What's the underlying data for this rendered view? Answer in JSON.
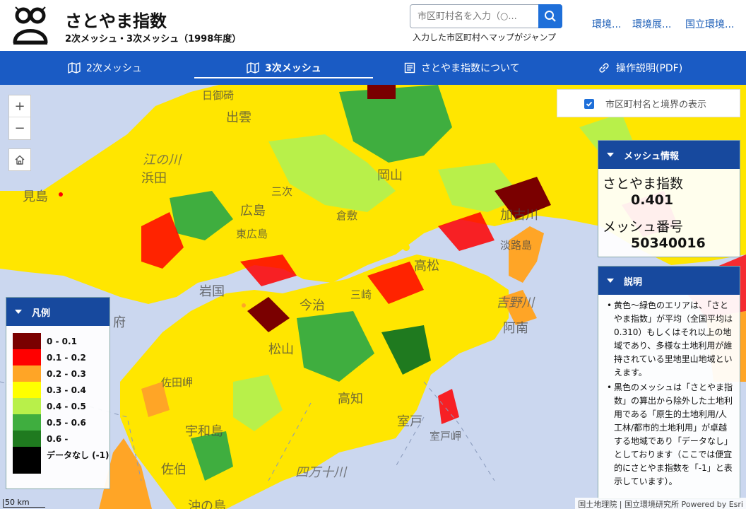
{
  "header": {
    "title": "さとやま指数",
    "subtitle": "2次メッシュ・3次メッシュ（1998年度）",
    "search_placeholder": "市区町村名を入力（○...",
    "search_hint": "入力した市区町村へマップがジャンプ",
    "links": [
      "環境...",
      "環境展...",
      "国立環境..."
    ]
  },
  "nav": {
    "tabs": [
      {
        "label": "2次メッシュ",
        "icon": "map-icon",
        "active": false
      },
      {
        "label": "3次メッシュ",
        "icon": "map-icon",
        "active": true
      },
      {
        "label": "さとやま指数について",
        "icon": "document-icon",
        "active": false
      },
      {
        "label": "操作説明(PDF)",
        "icon": "link-icon",
        "active": false
      }
    ]
  },
  "map": {
    "toggle_label": "市区町村名と境界の表示",
    "toggle_checked": true,
    "zoom_in": "+",
    "zoom_out": "−",
    "place_names": [
      "日御碕",
      "出雲",
      "江の川",
      "浜田",
      "見島",
      "三次",
      "広島",
      "東広島",
      "岡山",
      "倉敷",
      "加古川",
      "淡路島",
      "岩国",
      "今治",
      "松山",
      "三崎",
      "高松",
      "吉野川",
      "阿南",
      "府",
      "佐田岬",
      "宇和島",
      "高知",
      "室戸",
      "室戸岬",
      "四万十川",
      "佐伯",
      "沖の島"
    ],
    "scale_label": "50 km",
    "attribution": "国土地理院 | 国立環境研究所   Powered by Esri"
  },
  "mesh_info": {
    "header": "メッシュ情報",
    "index_label": "さとやま指数",
    "index_value": "0.401",
    "mesh_label": "メッシュ番号",
    "mesh_value": "50340016"
  },
  "description": {
    "header": "説明",
    "items": [
      "黄色〜緑色のエリアは、「さとやま指数」が平均（全国平均は0.310）もしくはそれ以上の地域であり、多様な土地利用が維持されている里地里山地域といえます。",
      "黒色のメッシュは「さとやま指数」の算出から除外した土地利用である「原生的土地利用/人工林/都市的土地利用」が卓越する地域であり「データなし」としております（ここでは便宜的にさとやま指数を「-1」と表示しています）。"
    ]
  },
  "legend": {
    "header": "凡例",
    "items": [
      {
        "label": "0 - 0.1",
        "color": "#7a0000"
      },
      {
        "label": "0.1 - 0.2",
        "color": "#ff0000"
      },
      {
        "label": "0.2 - 0.3",
        "color": "#ffa526"
      },
      {
        "label": "0.3 - 0.4",
        "color": "#ffff00"
      },
      {
        "label": "0.4 - 0.5",
        "color": "#b8f04a"
      },
      {
        "label": "0.5 - 0.6",
        "color": "#3fae3f"
      },
      {
        "label": "0.6 -",
        "color": "#1f7a1f"
      },
      {
        "label": "データなし (-1)",
        "color": "#000000"
      }
    ]
  }
}
